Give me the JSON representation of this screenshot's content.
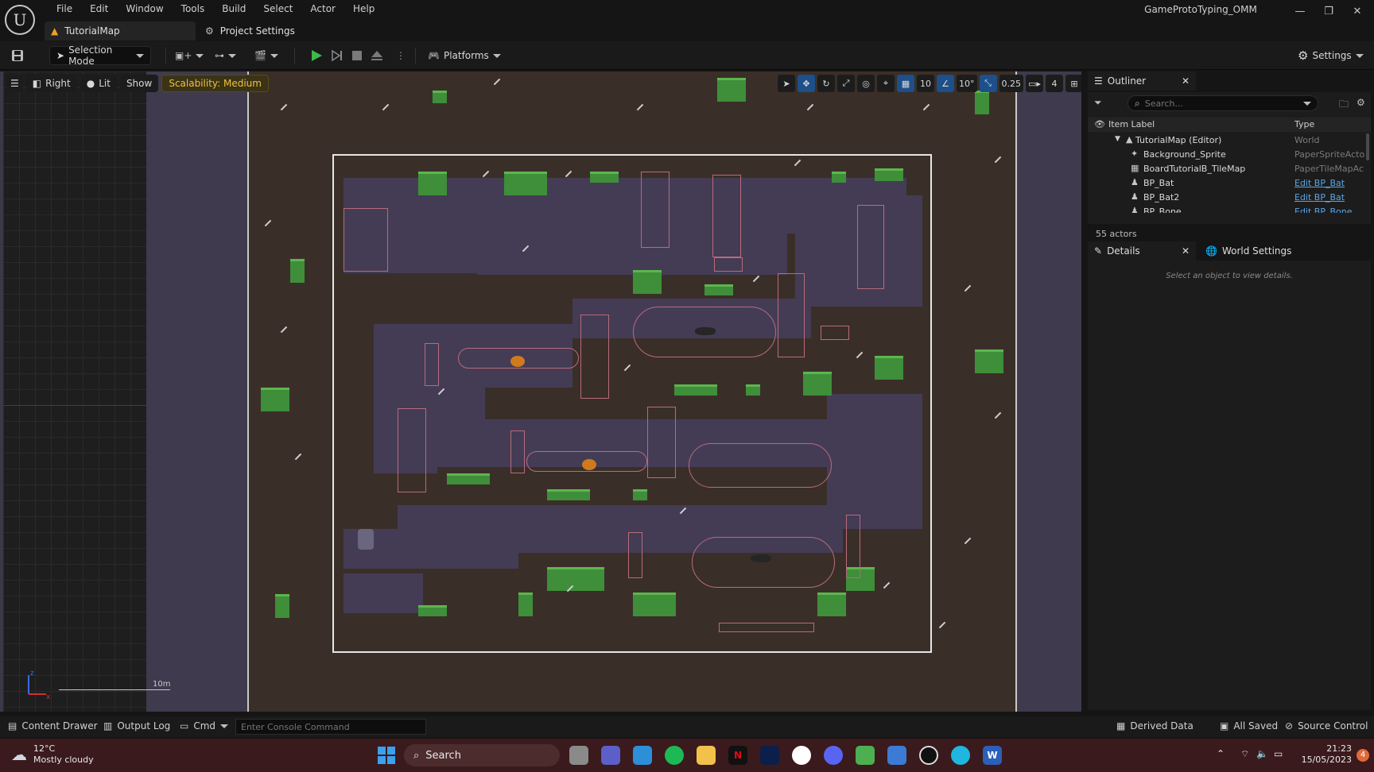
{
  "window": {
    "project_name": "GameProtoTyping_OMM",
    "menu": [
      "File",
      "Edit",
      "Window",
      "Tools",
      "Build",
      "Select",
      "Actor",
      "Help"
    ],
    "tabs": [
      {
        "label": "TutorialMap",
        "active": true
      },
      {
        "label": "Project Settings",
        "active": false
      }
    ]
  },
  "toolbar": {
    "selection_mode": "Selection Mode",
    "platforms": "Platforms",
    "settings": "Settings"
  },
  "viewport": {
    "view_mode": "Right",
    "lighting": "Lit",
    "show": "Show",
    "scalability": "Scalability: Medium",
    "grid_snap": "10",
    "rotation_snap": "10°",
    "scale_snap": "0.25",
    "camera_speed": "4",
    "scale_label": "10m"
  },
  "outliner": {
    "title": "Outliner",
    "search_placeholder": "Search...",
    "columns": {
      "label": "Item Label",
      "type": "Type"
    },
    "rows": [
      {
        "name": "TutorialMap (Editor)",
        "type": "World",
        "link": false
      },
      {
        "name": "Background_Sprite",
        "type": "PaperSpriteActo",
        "link": false
      },
      {
        "name": "BoardTutorialB_TileMap",
        "type": "PaperTileMapAc",
        "link": false
      },
      {
        "name": "BP_Bat",
        "type": "Edit BP_Bat",
        "link": true
      },
      {
        "name": "BP_Bat2",
        "type": "Edit BP_Bat",
        "link": true
      },
      {
        "name": "BP_Bone",
        "type": "Edit BP_Bone",
        "link": true
      }
    ],
    "actor_count": "55 actors"
  },
  "details": {
    "title": "Details",
    "world_settings": "World Settings",
    "empty_message": "Select an object to view details."
  },
  "statusbar": {
    "content_drawer": "Content Drawer",
    "output_log": "Output Log",
    "cmd": "Cmd",
    "console_placeholder": "Enter Console Command",
    "derived_data": "Derived Data",
    "all_saved": "All Saved",
    "source_control": "Source Control"
  },
  "taskbar": {
    "temperature": "12°C",
    "weather": "Mostly cloudy",
    "search": "Search",
    "time": "21:23",
    "date": "15/05/2023",
    "notifications": "4"
  },
  "colors": {
    "accent_blue": "#1d4f8a",
    "grass": "#3f8e3a",
    "cave": "#443c55",
    "dirt": "#3a2f28",
    "taskbar": "#3a1a1c"
  }
}
